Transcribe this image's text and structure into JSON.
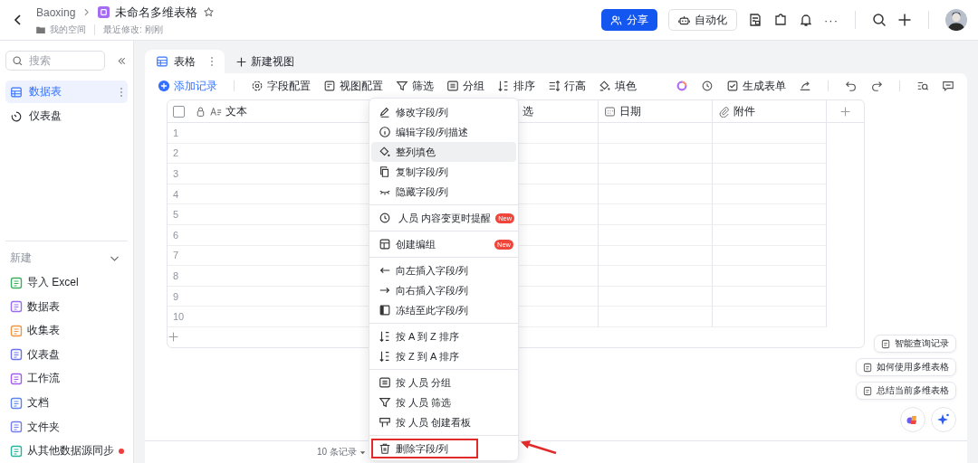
{
  "header": {
    "breadcrumb": "Baoxing",
    "title": "未命名多维表格",
    "location": "我的空间",
    "modified": "最近修改: 刚刚",
    "more": "···",
    "buttons": [
      {
        "label": "分享",
        "kind": "primary"
      },
      {
        "label": "自动化",
        "kind": "outline"
      }
    ]
  },
  "sidebar": {
    "search": {
      "placeholder": "搜索"
    },
    "items": [
      {
        "label": "数据表",
        "selected": true
      },
      {
        "label": "仪表盘",
        "selected": false
      }
    ],
    "new_section": {
      "label": "新建",
      "items": [
        {
          "label": "导入 Excel",
          "color": "#3aaf5c",
          "unread": false
        },
        {
          "label": "数据表",
          "color": "#9a6cf2",
          "unread": false
        },
        {
          "label": "收集表",
          "color": "#f29440",
          "unread": false
        },
        {
          "label": "仪表盘",
          "color": "#6a70ee",
          "unread": false
        },
        {
          "label": "工作流",
          "color": "#a35cf0",
          "unread": false
        },
        {
          "label": "文档",
          "color": "#5b84f0",
          "unread": false
        },
        {
          "label": "文件夹",
          "color": "#737cf0",
          "unread": false
        },
        {
          "label": "从其他数据源同步",
          "color": "#27b39a",
          "unread": true
        }
      ]
    }
  },
  "tabs": [
    {
      "label": "表格",
      "selected": true
    }
  ],
  "new_view": "新建视图",
  "toolbar": {
    "add_record": "添加记录",
    "tools": [
      "字段配置",
      "视图配置",
      "筛选",
      "分组",
      "排序",
      "行高",
      "填色"
    ],
    "generate_form": "生成表单"
  },
  "table": {
    "columns": [
      {
        "label": "文本",
        "kind": "text"
      },
      {
        "label": "选",
        "kind": "select"
      },
      {
        "label": "日期",
        "kind": "date"
      },
      {
        "label": "附件",
        "kind": "attachment"
      }
    ],
    "select_all": {
      "checked": false
    },
    "rows": [
      "1",
      "2",
      "3",
      "4",
      "5",
      "6",
      "7",
      "8",
      "9",
      "10"
    ],
    "record_count": "10 条记录"
  },
  "context_menu": {
    "groups": [
      [
        {
          "label": "修改字段/列",
          "kind": "edit",
          "hovered": false,
          "outlined": false
        },
        {
          "label": "编辑字段/列描述",
          "kind": "info",
          "hovered": false,
          "outlined": false
        },
        {
          "label": "整列填色",
          "kind": "fill",
          "hovered": true,
          "outlined": false
        },
        {
          "label": "复制字段/列",
          "kind": "copy",
          "hovered": false,
          "outlined": false
        },
        {
          "label": "隐藏字段/列",
          "kind": "hide",
          "hovered": false,
          "outlined": false
        }
      ],
      [
        {
          "label": " 人员 内容变更时提醒",
          "kind": "remind",
          "hovered": false,
          "outlined": false,
          "badge": "New"
        }
      ],
      [
        {
          "label": "创建编组",
          "kind": "group",
          "hovered": false,
          "outlined": false,
          "badge": "New"
        }
      ],
      [
        {
          "label": "向左插入字段/列",
          "kind": "left",
          "hovered": false,
          "outlined": false
        },
        {
          "label": "向右插入字段/列",
          "kind": "right",
          "hovered": false,
          "outlined": false
        },
        {
          "label": "冻结至此字段/列",
          "kind": "freeze",
          "hovered": false,
          "outlined": false
        }
      ],
      [
        {
          "label": "按 A 到 Z 排序",
          "kind": "sort",
          "hovered": false,
          "outlined": false
        },
        {
          "label": "按 Z 到 A 排序",
          "kind": "sort",
          "hovered": false,
          "outlined": false
        }
      ],
      [
        {
          "label": "按 人员 分组",
          "kind": "list",
          "hovered": false,
          "outlined": false
        },
        {
          "label": "按 人员 筛选",
          "kind": "filter",
          "hovered": false,
          "outlined": false
        },
        {
          "label": "按 人员 创建看板",
          "kind": "board",
          "hovered": false,
          "outlined": false
        }
      ],
      [
        {
          "label": "删除字段/列",
          "kind": "delete",
          "hovered": false,
          "outlined": true
        }
      ]
    ]
  },
  "ai_suggestions": [
    "智能查询记录",
    "如何使用多维表格",
    "总结当前多维表格"
  ]
}
